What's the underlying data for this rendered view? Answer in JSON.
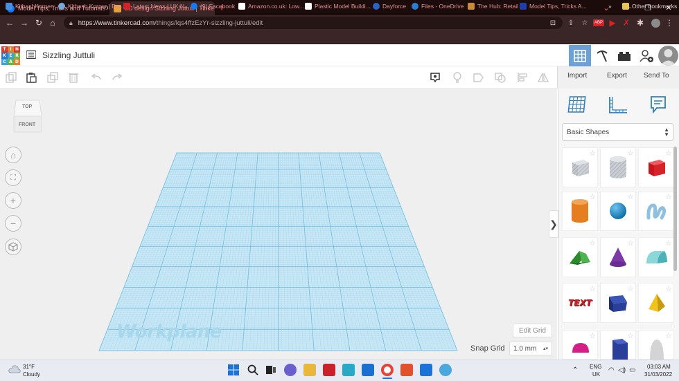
{
  "browser": {
    "tabs": [
      {
        "label": "Model Tips, Tricks and Tutorials",
        "active": false,
        "icon": "facebook-icon",
        "icon_color": "#1877f2"
      },
      {
        "label": "3D design Sizzling Juttuli | Tinke",
        "active": true,
        "icon": "tinkercad-icon",
        "icon_color": "#e8a03a"
      }
    ],
    "url_host": "https://www.tinkercad.com",
    "url_path": "/things/lqs4ffzEzYr-sizzling-juttuli/edit",
    "bookmarks": [
      {
        "label": "KitbashKorner",
        "color": "#4a90e2"
      },
      {
        "label": "Kitbash Korner | De...",
        "color": "#7aa6d8"
      },
      {
        "label": "Latest News | UK N...",
        "color": "#d2232a"
      },
      {
        "label": "(9) Facebook",
        "color": "#1877f2"
      },
      {
        "label": "Amazon.co.uk: Low...",
        "color": "#ffffff"
      },
      {
        "label": "Plastic Model Buildi...",
        "color": "#ffffff"
      },
      {
        "label": "Dayforce",
        "color": "#2a63c6"
      },
      {
        "label": "Files - OneDrive",
        "color": "#2b7cd3"
      },
      {
        "label": "The Hub: Retail",
        "color": "#c98a3a"
      },
      {
        "label": "Model Tips, Tricks A...",
        "color": "#1f3fa8"
      }
    ],
    "other_bookmarks": "Other bookmarks"
  },
  "app": {
    "logo_letters": [
      "TIN",
      "KER",
      "CAD"
    ],
    "design_title": "Sizzling Juttuli",
    "actions": {
      "import": "Import",
      "export": "Export",
      "send_to": "Send To"
    }
  },
  "canvas": {
    "viewcube_top": "TOP",
    "viewcube_front": "FRONT",
    "workplane_label": "Workplane",
    "edit_grid": "Edit Grid",
    "snap_grid_label": "Snap Grid",
    "snap_grid_value": "1.0 mm"
  },
  "sidebar": {
    "category": "Basic Shapes",
    "shapes": [
      {
        "name": "box-hole",
        "color": "#b8bcc4"
      },
      {
        "name": "cylinder-hole",
        "color": "#c4c7cc"
      },
      {
        "name": "box",
        "color": "#d6232a"
      },
      {
        "name": "cylinder",
        "color": "#e67e1f"
      },
      {
        "name": "sphere",
        "color": "#1d8fd3"
      },
      {
        "name": "scribble",
        "color": "#7ab3d8"
      },
      {
        "name": "roof",
        "color": "#3a9e3a"
      },
      {
        "name": "cone",
        "color": "#7c3aa8"
      },
      {
        "name": "round-roof",
        "color": "#5bc4c9"
      },
      {
        "name": "text",
        "color": "#c8232a"
      },
      {
        "name": "wedge",
        "color": "#2a3f9a"
      },
      {
        "name": "pyramid",
        "color": "#f0c31e"
      },
      {
        "name": "half-sphere",
        "color": "#d61f86"
      },
      {
        "name": "polygon",
        "color": "#2a3f9a"
      },
      {
        "name": "paraboloid",
        "color": "#d0d0d0"
      }
    ],
    "text_shape_label": "TEXT"
  },
  "taskbar": {
    "weather_temp": "31°F",
    "weather_text": "Cloudy",
    "lang": "ENG",
    "region": "UK",
    "time": "03:03 AM",
    "date": "31/03/2022"
  }
}
